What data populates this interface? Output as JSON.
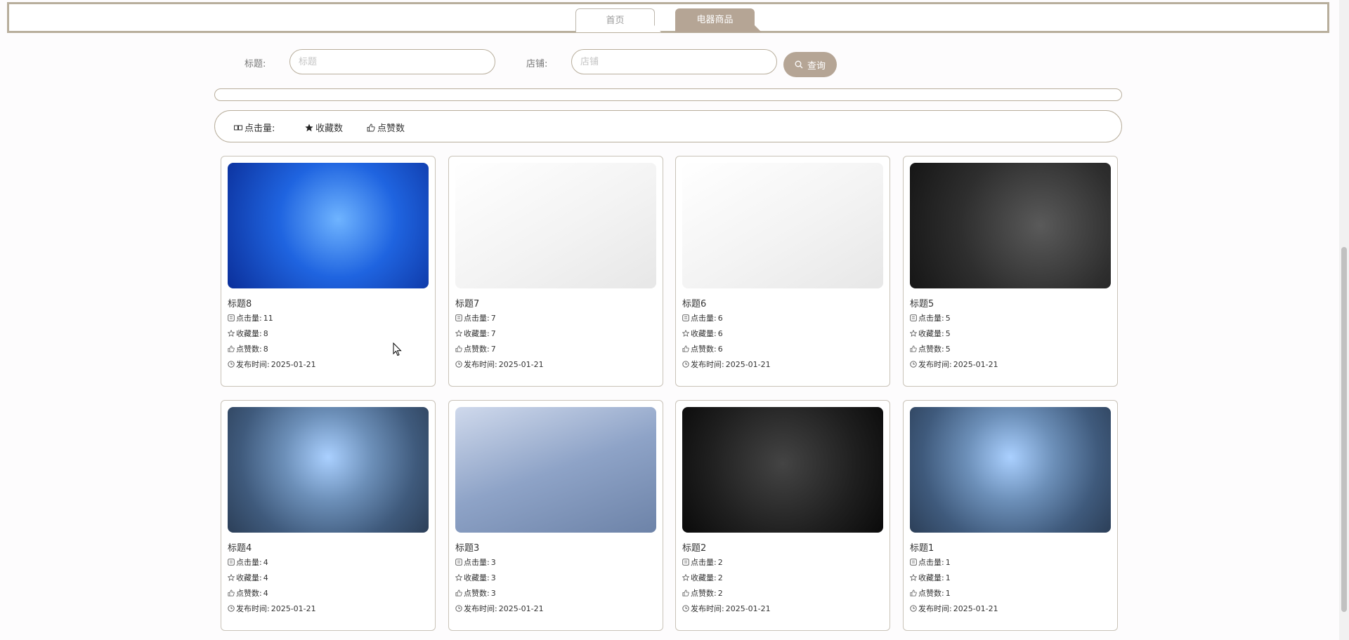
{
  "nav": {
    "tab_home": "首页",
    "tab_active": "电器商品"
  },
  "search": {
    "title_label": "标题:",
    "title_placeholder": "标题",
    "shop_label": "店铺:",
    "shop_placeholder": "店铺",
    "button_label": "查询"
  },
  "sort": {
    "clicks": "点击量:",
    "favorites": "收藏数",
    "likes": "点赞数"
  },
  "meta_labels": {
    "clicks": "点击量:",
    "favorites": "收藏量:",
    "likes": "点赞数:",
    "published": "发布时间:"
  },
  "colors": {
    "accent": "#b5a595",
    "border": "#b8ae9c"
  },
  "cards": [
    {
      "title": "标题8",
      "clicks": "11",
      "favorites": "8",
      "likes": "8",
      "date": "2025-01-21",
      "image": "blue-tech-display"
    },
    {
      "title": "标题7",
      "clicks": "7",
      "favorites": "7",
      "likes": "7",
      "date": "2025-01-21",
      "image": "white-earbuds"
    },
    {
      "title": "标题6",
      "clicks": "6",
      "favorites": "6",
      "likes": "6",
      "date": "2025-01-21",
      "image": "white-earbuds"
    },
    {
      "title": "标题5",
      "clicks": "5",
      "favorites": "5",
      "likes": "5",
      "date": "2025-01-21",
      "image": "dark-speaker"
    },
    {
      "title": "标题4",
      "clicks": "4",
      "favorites": "4",
      "likes": "4",
      "date": "2025-01-21",
      "image": "cpu-chip"
    },
    {
      "title": "标题3",
      "clicks": "3",
      "favorites": "3",
      "likes": "3",
      "date": "2025-01-21",
      "image": "headphones"
    },
    {
      "title": "标题2",
      "clicks": "2",
      "favorites": "2",
      "likes": "2",
      "date": "2025-01-21",
      "image": "laptop-devices"
    },
    {
      "title": "标题1",
      "clicks": "1",
      "favorites": "1",
      "likes": "1",
      "date": "2025-01-21",
      "image": "cpu-chip"
    }
  ]
}
